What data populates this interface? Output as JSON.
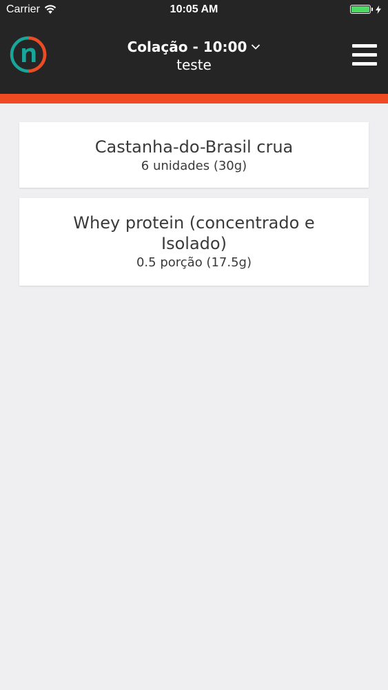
{
  "status_bar": {
    "carrier": "Carrier",
    "time": "10:05 AM",
    "battery_color": "#4cd964"
  },
  "nav": {
    "logo_icon": "nutrition-logo-icon",
    "title": "Colação - 10:00",
    "title_chevron_icon": "chevron-down-icon",
    "subtitle": "teste",
    "menu_icon": "hamburger-menu-icon"
  },
  "colors": {
    "header_bg": "#252525",
    "accent": "#f04a22",
    "logo_teal": "#1aa59a",
    "page_bg": "#efeff1"
  },
  "foods": [
    {
      "name": "Castanha-do-Brasil crua",
      "portion": "6 unidades (30g)"
    },
    {
      "name": "Whey protein (concentrado e Isolado)",
      "portion": "0.5 porção (17.5g)"
    }
  ]
}
